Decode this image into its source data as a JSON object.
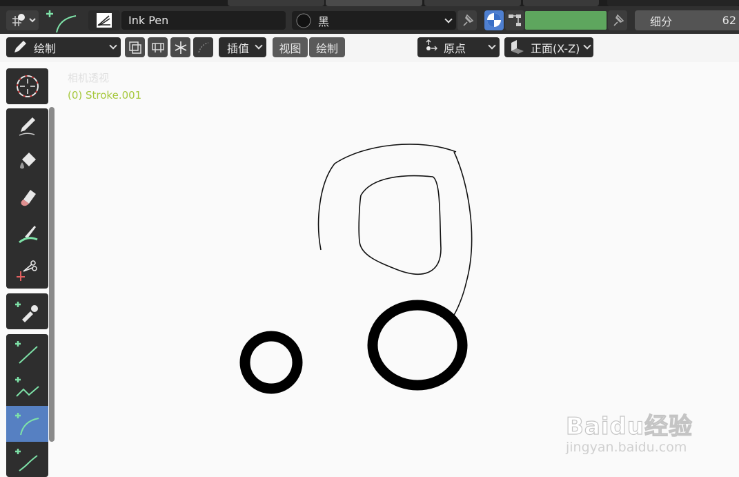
{
  "header": {
    "brush_name": "Ink Pen",
    "material_name": "黑",
    "subdivision_label": "细分",
    "subdivision_value": "62"
  },
  "toolbar2": {
    "mode_label": "绘制",
    "interp_label": "插值",
    "view_label": "视图",
    "draw_label": "绘制",
    "origin_label": "原点",
    "plane_label": "正面(X-Z)"
  },
  "viewport": {
    "perspective_label": "相机透视",
    "object_label": "(0) Stroke.001"
  },
  "watermark": {
    "brand": "Baidu经验",
    "url": "jingyan.baidu.com"
  },
  "colors": {
    "active_tool": "#5680c2",
    "object_label": "#a6c83c",
    "color_bar": "#5ea65e"
  },
  "icons": {
    "cursor_tool": "crosshair-icon",
    "draw_tool": "pencil-icon",
    "fill_tool": "bucket-icon",
    "erase_tool": "eraser-icon",
    "tint_tool": "brush-icon",
    "cutter_tool": "scissors-icon",
    "eyedropper_tool": "eyedropper-icon",
    "line_tool": "line-icon",
    "polyline_tool": "polyline-icon",
    "arc_tool": "arc-icon",
    "curve_tool": "curve-icon"
  }
}
